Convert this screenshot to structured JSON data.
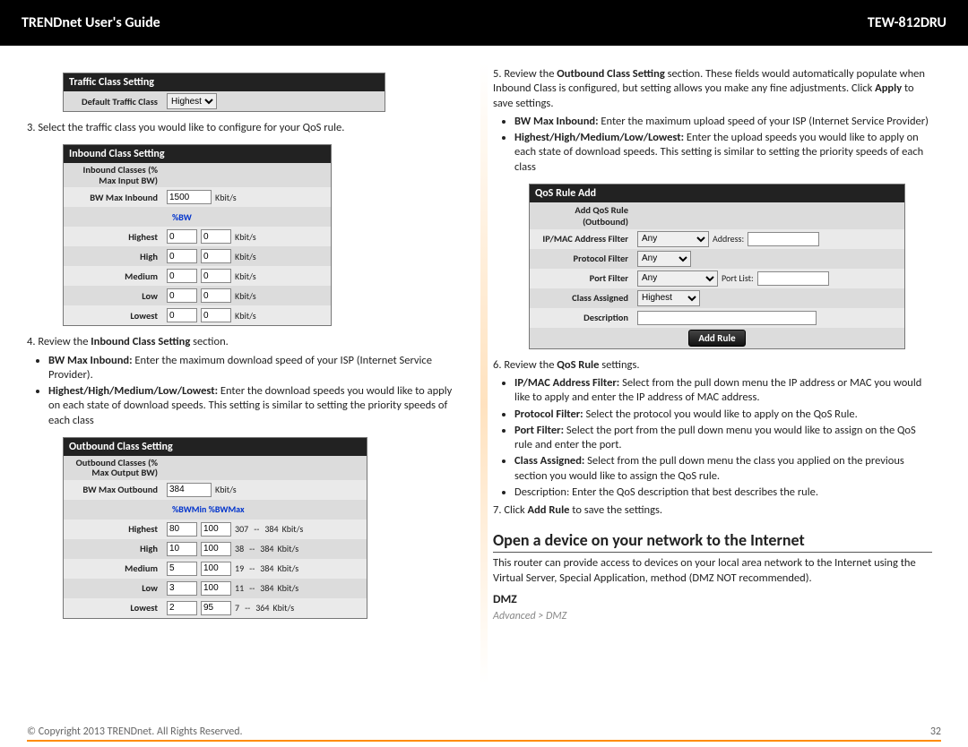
{
  "header": {
    "left": "TRENDnet User's Guide",
    "right": "TEW-812DRU"
  },
  "left": {
    "panel1": {
      "title": "Traffic Class Setting",
      "label": "Default Traffic Class",
      "value": "Highest"
    },
    "step3": "3. Select the traffic class you would like to configure for your QoS rule.",
    "panel2": {
      "title": "Inbound Class Setting",
      "subhead": "Inbound Classes (% Max Input BW)",
      "bw_label": "BW Max Inbound",
      "bw_value": "1500",
      "bw_unit": "Kbit/s",
      "pctbw": "%BW",
      "rows": [
        {
          "label": "Highest",
          "a": "0",
          "b": "0",
          "unit": "Kbit/s"
        },
        {
          "label": "High",
          "a": "0",
          "b": "0",
          "unit": "Kbit/s"
        },
        {
          "label": "Medium",
          "a": "0",
          "b": "0",
          "unit": "Kbit/s"
        },
        {
          "label": "Low",
          "a": "0",
          "b": "0",
          "unit": "Kbit/s"
        },
        {
          "label": "Lowest",
          "a": "0",
          "b": "0",
          "unit": "Kbit/s"
        }
      ]
    },
    "step4": "4. Review the Inbound Class Setting section.",
    "step4_b1_strong": "BW Max Inbound:",
    "step4_b1": " Enter the maximum download speed of your ISP (Internet Service Provider).",
    "step4_b2_strong": "Highest/High/Medium/Low/Lowest:",
    "step4_b2": " Enter the download speeds you would like to apply on each state of download speeds. This setting is similar to setting the priority speeds of each class",
    "panel3": {
      "title": "Outbound Class Setting",
      "subhead": "Outbound Classes (% Max Output BW)",
      "bw_label": "BW Max Outbound",
      "bw_value": "384",
      "bw_unit": "Kbit/s",
      "sub2": "%BWMin   %BWMax",
      "rows": [
        {
          "label": "Highest",
          "a": "80",
          "b": "100",
          "c": "307",
          "d": "384",
          "unit": "Kbit/s"
        },
        {
          "label": "High",
          "a": "10",
          "b": "100",
          "c": "38",
          "d": "384",
          "unit": "Kbit/s"
        },
        {
          "label": "Medium",
          "a": "5",
          "b": "100",
          "c": "19",
          "d": "384",
          "unit": "Kbit/s"
        },
        {
          "label": "Low",
          "a": "3",
          "b": "100",
          "c": "11",
          "d": "384",
          "unit": "Kbit/s"
        },
        {
          "label": "Lowest",
          "a": "2",
          "b": "95",
          "c": "7",
          "d": "364",
          "unit": "Kbit/s"
        }
      ]
    }
  },
  "right": {
    "step5a": "5. Review the ",
    "step5b_strong": "Outbound Class Setting",
    "step5c": " section. These fields would automatically populate when Inbound Class is configured, but setting allows you make any fine adjustments. Click ",
    "step5d_strong": "Apply",
    "step5e": " to save settings.",
    "b1_strong": "BW Max Inbound:",
    "b1": " Enter the maximum upload speed of your ISP (Internet Service Provider)",
    "b2_strong": "Highest/High/Medium/Low/Lowest:",
    "b2": " Enter the upload speeds you would like to apply on each state of download speeds. This setting is similar to setting the priority speeds of each class",
    "panel": {
      "title": "QoS Rule Add",
      "outbound_label": "Add QoS Rule (Outbound)",
      "ipmac_label": "IP/MAC Address Filter",
      "ipmac_value": "Any",
      "addr_label": "Address:",
      "proto_label": "Protocol Filter",
      "proto_value": "Any",
      "port_label": "Port Filter",
      "port_value": "Any",
      "portlist_label": "Port List:",
      "class_label": "Class Assigned",
      "class_value": "Highest",
      "desc_label": "Description",
      "button": "Add Rule"
    },
    "step6": "6. Review the QoS Rule settings.",
    "qb1_strong": "IP/MAC Address Filter:",
    "qb1": " Select from the pull down menu the IP address or MAC you would like to apply and enter the IP address of MAC address.",
    "qb2_strong": "Protocol Filter:",
    "qb2": " Select the protocol you would like to apply on the QoS Rule.",
    "qb3_strong": "Port Filter:",
    "qb3": " Select the port from the pull down menu you would like to assign on the QoS rule and enter the port.",
    "qb4_strong": "Class Assigned:",
    "qb4": " Select from the pull down menu the class you applied on the previous section you would like to assign the QoS rule.",
    "qb5": "Description: Enter the QoS description that best describes the rule.",
    "step7a": "7. Click ",
    "step7b_strong": "Add Rule",
    "step7c": " to save the settings.",
    "section_title": "Open a device on your network to the Internet",
    "section_body": "This router can provide access to devices on your local area network to the Internet using the Virtual Server, Special Application, method (DMZ NOT recommended).",
    "dmz_heading": "DMZ",
    "breadcrumb": "Advanced > DMZ"
  },
  "footer": {
    "copyright": "© Copyright 2013 TRENDnet. All Rights Reserved.",
    "page": "32"
  }
}
